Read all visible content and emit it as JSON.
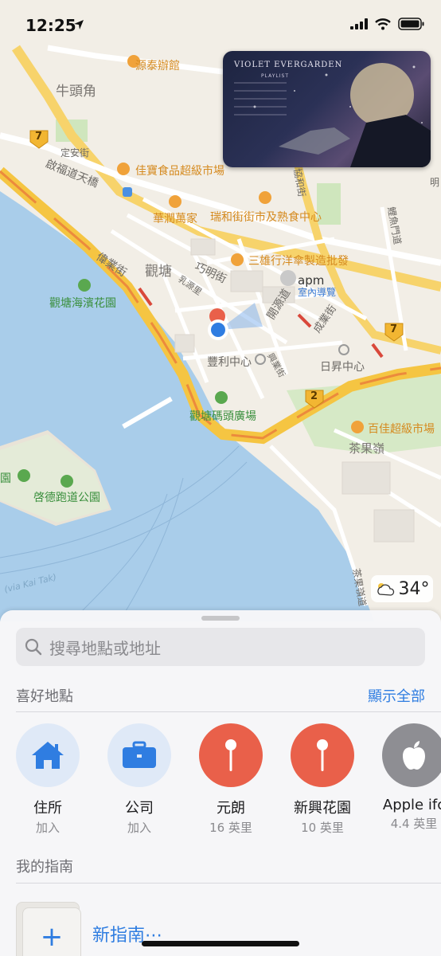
{
  "status_bar": {
    "time": "12:25"
  },
  "map": {
    "labels": {
      "yuen_tai_restaurant": "源泰辦館",
      "ngau_tau_kok": "牛頭角",
      "ding_on_street": "定安街",
      "kai_fuk_road": "啟福道天橋",
      "kai_bo_supermarket": "佳寶食品超級市場",
      "china_resources": "華潤萬家",
      "shui_wo_market": "瑞和街街市及熟食中心",
      "wai_yip_street": "偉業街",
      "kwun_tong": "觀塘",
      "hong_ming_street": "巧明街",
      "hoi_bun_road": "開源道",
      "sam_hung": "三雄行洋傘製造批發",
      "apm": "apm",
      "apm_sub": "室內導覽",
      "promenade": "觀塘海濱花園",
      "fu_lee_centre": "豐利中心",
      "yat_sing_centre": "日昇中心",
      "pier_square": "觀塘碼頭廣場",
      "best_mart": "百佳超級市場",
      "cha_kwo_ling": "茶果嶺",
      "kai_tak_runway": "啓德跑道公園",
      "via_kai_tak": "(via Kai Tak)",
      "route_7": "7",
      "route_2": "2",
      "ying_yip": "英業街",
      "shing_yip": "成業街",
      "hing_yip": "興業街",
      "how_ming": "巧明街",
      "lei_yue_mun_road": "鯉魚門道",
      "cha_kwo_ling_road": "茶果嶺道",
      "hip_wo": "協和街",
      "yuet_wah": "月華街",
      "yuen_road": "乳源里",
      "left_cut": "園",
      "top_right_cut": "明"
    },
    "pip": {
      "title": "VIOLET EVERGARDEN",
      "subtitle": "PLAYLIST"
    },
    "weather": {
      "icon": "partly-cloudy-icon",
      "temperature": "34°"
    }
  },
  "sheet": {
    "search_placeholder": "搜尋地點或地址",
    "favorites_title": "喜好地點",
    "show_all": "顯示全部",
    "favorites": [
      {
        "name": "住所",
        "sub": "加入",
        "icon": "home-icon"
      },
      {
        "name": "公司",
        "sub": "加入",
        "icon": "briefcase-icon"
      },
      {
        "name": "元朗",
        "sub": "16 英里",
        "icon": "pin-icon"
      },
      {
        "name": "新興花園",
        "sub": "10 英里",
        "icon": "pin-icon"
      },
      {
        "name": "Apple ifc",
        "sub": "4.4 英里",
        "icon": "apple-icon"
      }
    ],
    "guides_title": "我的指南",
    "new_guide": "新指南⋯"
  },
  "colors": {
    "accent": "#2f7de1",
    "pin_red": "#e9604a",
    "water": "#a9cdea",
    "highway": "#f5c542"
  }
}
